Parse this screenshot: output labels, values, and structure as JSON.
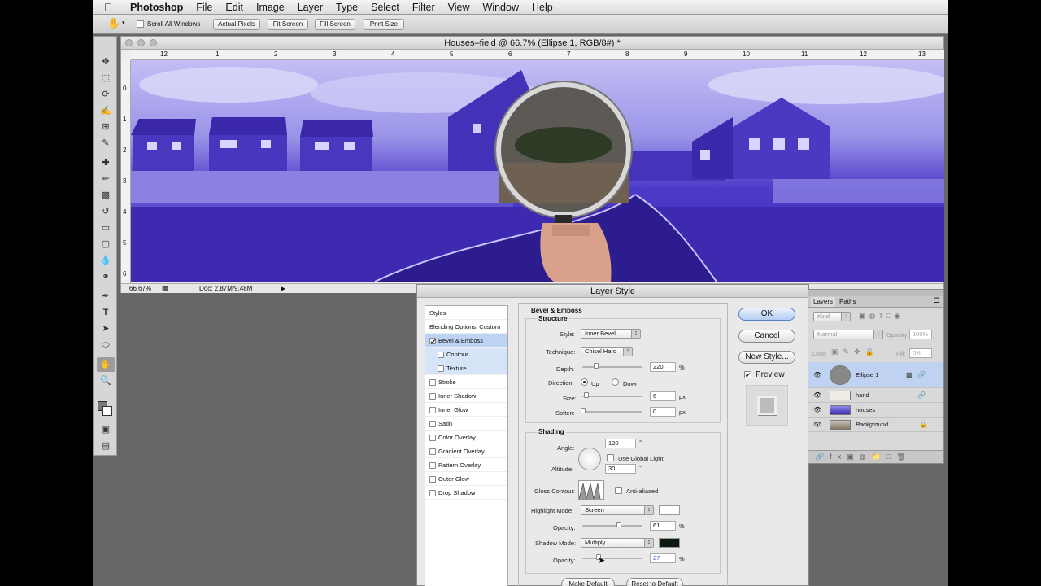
{
  "menubar": {
    "apple_icon": "apple-icon",
    "app_name": "Photoshop",
    "items": [
      "File",
      "Edit",
      "Image",
      "Layer",
      "Type",
      "Select",
      "Filter",
      "View",
      "Window",
      "Help"
    ]
  },
  "options": {
    "scroll_all_windows": "Scroll All Windows",
    "actual_pixels": "Actual Pixels",
    "fit_screen": "Fit Screen",
    "fill_screen": "Fill Screen",
    "print_size": "Print Size"
  },
  "document": {
    "title": "Houses–field @ 66.7% (Ellipse 1, RGB/8#) *",
    "zoom": "66.67%",
    "doc_size": "Doc: 2.87M/9.48M",
    "ruler_h": [
      "12",
      "1",
      "2",
      "3",
      "4",
      "5",
      "6",
      "7",
      "8",
      "9",
      "10",
      "11",
      "12",
      "13"
    ],
    "ruler_v": [
      "0",
      "1",
      "2",
      "3",
      "4",
      "5",
      "6"
    ]
  },
  "dialog": {
    "title": "Layer Style",
    "styles_header": "Styles",
    "blending_options": "Blending Options: Custom",
    "styles": [
      {
        "label": "Bevel & Emboss",
        "checked": true
      },
      {
        "label": "Contour",
        "checked": false
      },
      {
        "label": "Texture",
        "checked": false
      },
      {
        "label": "Stroke",
        "checked": false
      },
      {
        "label": "Inner Shadow",
        "checked": false
      },
      {
        "label": "Inner Glow",
        "checked": false
      },
      {
        "label": "Satin",
        "checked": false
      },
      {
        "label": "Color Overlay",
        "checked": false
      },
      {
        "label": "Gradient Overlay",
        "checked": false
      },
      {
        "label": "Pattern Overlay",
        "checked": false
      },
      {
        "label": "Outer Glow",
        "checked": false
      },
      {
        "label": "Drop Shadow",
        "checked": false
      }
    ],
    "bevel": {
      "heading": "Bevel & Emboss",
      "structure": "Structure",
      "style_label": "Style:",
      "style_value": "Inner Bevel",
      "technique_label": "Technique:",
      "technique_value": "Chisel Hard",
      "depth_label": "Depth:",
      "depth_value": "220",
      "depth_unit": "%",
      "direction_label": "Direction:",
      "up": "Up",
      "down": "Down",
      "size_label": "Size:",
      "size_value": "6",
      "size_unit": "px",
      "soften_label": "Soften:",
      "soften_value": "0",
      "soften_unit": "px",
      "shading": "Shading",
      "angle_label": "Angle:",
      "angle_value": "120",
      "angle_unit": "°",
      "global_light": "Use Global Light",
      "altitude_label": "Altitude:",
      "altitude_value": "30",
      "altitude_unit": "°",
      "gloss_label": "Gloss Contour:",
      "anti_aliased": "Anti-aliased",
      "highlight_label": "Highlight Mode:",
      "highlight_value": "Screen",
      "highlight_color": "#ffffff",
      "hl_opacity_label": "Opacity:",
      "hl_opacity_value": "61",
      "hl_opacity_unit": "%",
      "shadow_label": "Shadow Mode:",
      "shadow_value": "Multiply",
      "shadow_color": "#0c1a10",
      "sh_opacity_label": "Opacity:",
      "sh_opacity_value": "27",
      "sh_opacity_unit": "%",
      "make_default": "Make Default",
      "reset_default": "Reset to Default"
    },
    "ok": "OK",
    "cancel": "Cancel",
    "new_style": "New Style...",
    "preview": "Preview"
  },
  "layers": {
    "tabs": [
      "Layers",
      "Paths"
    ],
    "kind": "Kind",
    "mode": "Normal",
    "opacity_label": "Opacity:",
    "opacity_value": "100%",
    "lock_label": "Lock:",
    "fill_label": "Fill:",
    "fill_value": "0%",
    "items": [
      {
        "name": "Ellipse 1",
        "selected": true
      },
      {
        "name": "hand",
        "selected": false
      },
      {
        "name": "houses",
        "selected": false
      },
      {
        "name": "Background",
        "selected": false
      }
    ]
  },
  "colors": {
    "accent": "#3f2bb5",
    "selection": "#bcd3f4"
  }
}
